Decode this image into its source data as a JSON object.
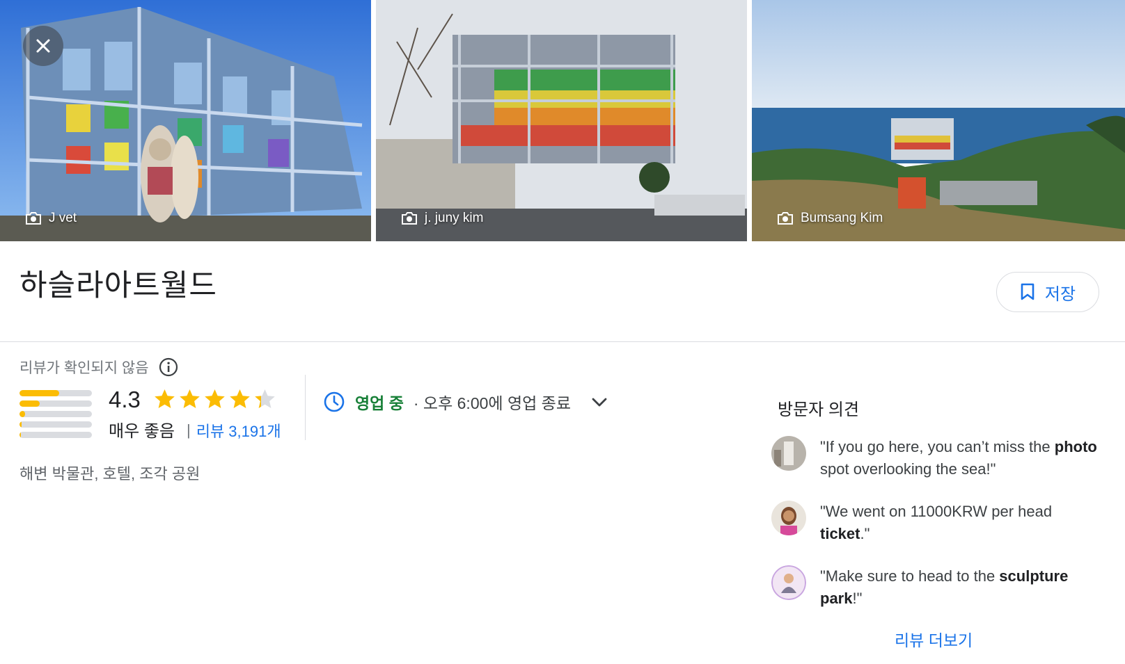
{
  "photos": [
    {
      "credit": "J vet"
    },
    {
      "credit": "j. juny kim"
    },
    {
      "credit": "Bumsang Kim"
    }
  ],
  "place": {
    "name": "하슬라아트월드",
    "save_label": "저장",
    "unverified_label": "리뷰가 확인되지 않음",
    "rating": "4.3",
    "rating_fraction": 0.86,
    "rating_word": "매우 좋음",
    "review_separator": "|",
    "review_count_label": "리뷰 3,191개",
    "rating_distribution": [
      0.55,
      0.28,
      0.08,
      0.03,
      0.02
    ],
    "open_status": "영업 중",
    "close_time": "· 오후 6:00에 영업 종료",
    "categories": "해변 박물관, 호텔, 조각 공원"
  },
  "opinions": {
    "title": "방문자 의견",
    "items": [
      {
        "before": "\"If you go here, you can’t miss the ",
        "bold": "photo",
        "after": " spot overlooking the sea!\""
      },
      {
        "before": "\"We went on 11000KRW per head ",
        "bold": "ticket",
        "after": ".\""
      },
      {
        "before": "\"Make sure to head to the ",
        "bold": "sculpture park",
        "after": "!\""
      }
    ],
    "more_label": "리뷰 더보기"
  },
  "colors": {
    "accent": "#1a73e8",
    "open_green": "#188038",
    "star": "#fbbc04",
    "star_empty": "#dadce0"
  },
  "icons": [
    "close-icon",
    "camera-icon",
    "bookmark-icon",
    "info-icon",
    "star-icon",
    "clock-icon",
    "chevron-down-icon"
  ]
}
